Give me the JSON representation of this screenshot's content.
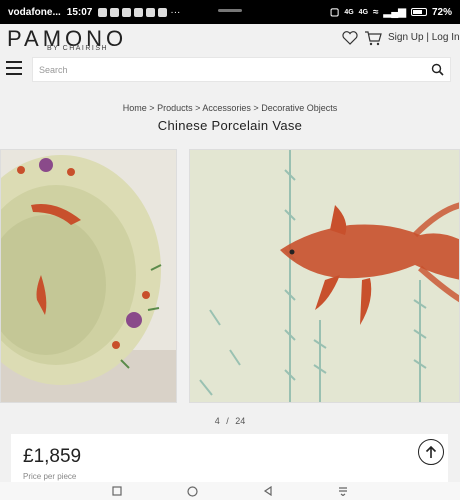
{
  "status_bar": {
    "carrier": "vodafone...",
    "time": "15:07",
    "notif_icons": [
      "key-icon",
      "eye-icon",
      "facebook-icon",
      "mail-icon",
      "app-icon",
      "instagram-icon"
    ],
    "more": "···",
    "signal_labels": [
      "4G",
      "4G"
    ],
    "battery": "72%",
    "battery_level": 0.72
  },
  "header": {
    "logo": "PAMONO",
    "logo_sub": "BY CHAIRISH",
    "sign_up": "Sign Up",
    "separator": "|",
    "log_in": "Log In",
    "search_placeholder": "Search"
  },
  "breadcrumb": {
    "items": [
      "Home",
      "Products",
      "Accessories",
      "Decorative Objects"
    ],
    "sep": ">"
  },
  "product": {
    "title": "Chinese Porcelain Vase",
    "image_current": "4",
    "image_sep": "/",
    "image_total": "24",
    "price": "£1,859",
    "price_note": "Price per piece"
  },
  "colors": {
    "accent": "#222222",
    "background": "#f1f1f1",
    "fish": "#c8502c",
    "flower": "#8a4a8a",
    "porcelain": "#dcdcb4"
  }
}
